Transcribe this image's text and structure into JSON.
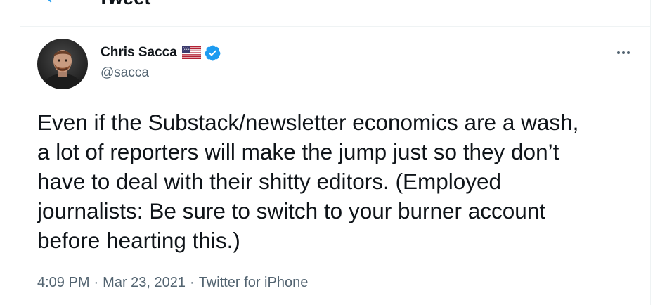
{
  "header": {
    "title": "Tweet",
    "back_icon": "arrow-left-icon"
  },
  "tweet": {
    "author": {
      "display_name": "Chris Sacca",
      "handle": "@sacca",
      "flag_icon": "us-flag-icon",
      "verified_icon": "verified-badge-icon"
    },
    "more_icon": "more-options-icon",
    "text": "Even if the Substack/newsletter economics are a wash,\na lot of reporters will make the jump just so they don’t\nhave to deal with their shitty editors. (Employed\njournalists: Be sure to switch to your burner account\nbefore hearting this.)",
    "meta": {
      "time": "4:09 PM",
      "date": "Mar 23, 2021",
      "separator": "·",
      "source": "Twitter for iPhone"
    }
  },
  "colors": {
    "text": "#0f1419",
    "secondary": "#536471",
    "accent": "#1d9bf0",
    "border": "#eff3f4"
  }
}
